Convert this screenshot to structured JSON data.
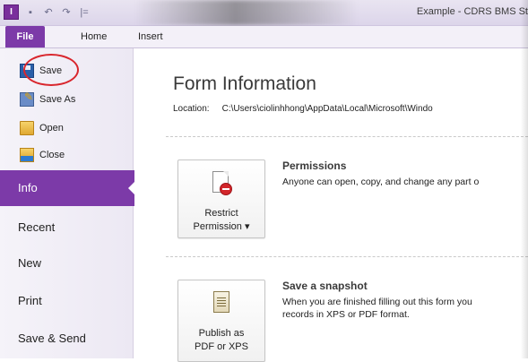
{
  "window": {
    "title": "Example - CDRS BMS St",
    "app_icon_letter": "I"
  },
  "quick_access": [
    {
      "name": "save-icon",
      "glyph": "▪"
    },
    {
      "name": "undo-icon",
      "glyph": "↶"
    },
    {
      "name": "redo-icon",
      "glyph": "↷"
    },
    {
      "name": "customize-icon",
      "glyph": "|="
    }
  ],
  "ribbon_tabs": [
    {
      "label": "File",
      "active": true
    },
    {
      "label": "Home"
    },
    {
      "label": "Insert"
    }
  ],
  "backstage_commands": [
    {
      "label": "Save",
      "icon": "save-icon",
      "highlighted": true
    },
    {
      "label": "Save As",
      "icon": "save-as-icon"
    },
    {
      "label": "Open",
      "icon": "open-folder-icon"
    },
    {
      "label": "Close",
      "icon": "close-folder-icon"
    }
  ],
  "backstage_nav": [
    {
      "label": "Info",
      "active": true
    },
    {
      "label": "Recent"
    },
    {
      "label": "New"
    },
    {
      "label": "Print"
    },
    {
      "label": "Save & Send"
    }
  ],
  "main": {
    "heading": "Form Information",
    "location_label": "Location:",
    "location_value": "C:\\Users\\ciolinhhong\\AppData\\Local\\Microsoft\\Windo",
    "sections": [
      {
        "button_label_line1": "Restrict",
        "button_label_line2": "Permission ▾",
        "title": "Permissions",
        "description": "Anyone can open, copy, and change any part o",
        "icon": "restrict-permission-icon"
      },
      {
        "button_label_line1": "Publish as",
        "button_label_line2": "PDF or XPS",
        "title": "Save a snapshot",
        "description_line1": "When you are finished filling out this form you",
        "description_line2": "records in XPS or PDF format.",
        "icon": "publish-pdf-icon"
      }
    ]
  },
  "colors": {
    "accent": "#7c3aa8",
    "highlight_ring": "#d9262d"
  }
}
